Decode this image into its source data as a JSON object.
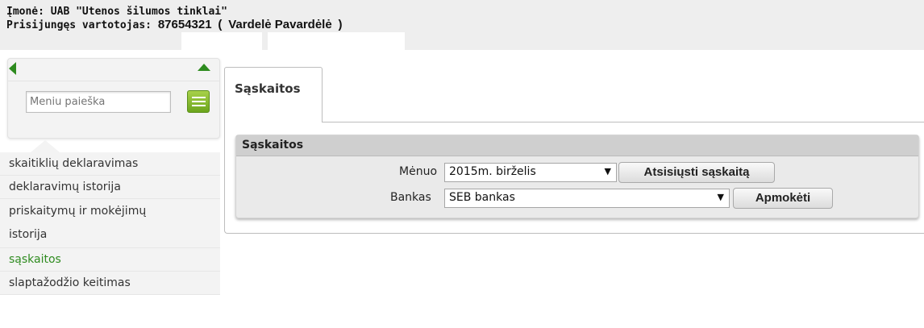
{
  "header": {
    "company_label": "Įmonė: UAB \"Utenos šilumos tinklai\"",
    "user_prefix": "Prisijungęs vartotojas:",
    "user_id": "87654321",
    "user_name_open": "(",
    "user_name": "Vardelė Pavardėlė",
    "user_name_close": ")"
  },
  "sidebar": {
    "search_placeholder": "Meniu paieška",
    "items": [
      {
        "label": "skaitiklių deklaravimas"
      },
      {
        "label": "deklaravimų istorija"
      },
      {
        "label_line1": "priskaitymų ir mokėjimų",
        "label_line2": "istorija"
      },
      {
        "label": "sąskaitos",
        "active": true
      },
      {
        "label": "slaptažodžio keitimas"
      }
    ],
    "accent_color": "#2e8b1f"
  },
  "main": {
    "tab_label": "Sąskaitos",
    "panel_title": "Sąskaitos",
    "month_label": "Mėnuo",
    "month_value": "2015m. birželis",
    "download_button": "Atsisiųsti sąskaitą",
    "bank_label": "Bankas",
    "bank_value": "SEB bankas",
    "pay_button": "Apmokėti",
    "caret_glyph": "▼"
  }
}
